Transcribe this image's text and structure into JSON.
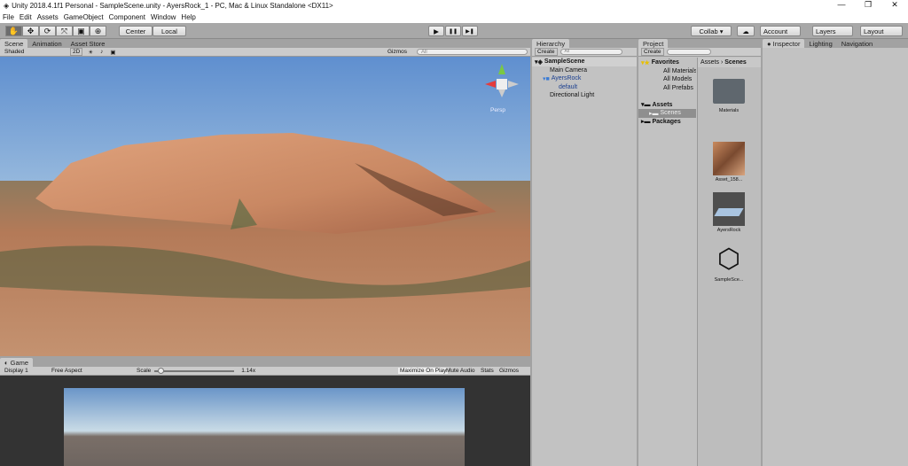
{
  "window": {
    "title": "Unity 2018.4.1f1 Personal - SampleScene.unity - AyersRock_1 - PC, Mac & Linux Standalone <DX11>",
    "controls": [
      "—",
      "❐",
      "✕"
    ]
  },
  "menu": [
    "File",
    "Edit",
    "Assets",
    "GameObject",
    "Component",
    "Window",
    "Help"
  ],
  "toolbar": {
    "tools": [
      "✋",
      "✥",
      "⟳",
      "⤧",
      "▣",
      "⊕"
    ],
    "pivot": "Center",
    "space": "Local",
    "play": "▶",
    "pause": "❚❚",
    "step": "▶❚",
    "collab": "Collab ▾",
    "cloud": "☁",
    "account": "Account",
    "layers": "Layers",
    "layout": "Layout"
  },
  "scene": {
    "tabs": [
      "Scene",
      "Animation",
      "Asset Store"
    ],
    "shading": "Shaded",
    "mode2d": "2D",
    "gizmos": "Gizmos",
    "search_placeholder": "All",
    "view_label": "Persp"
  },
  "game": {
    "tab": "Game",
    "display": "Display 1",
    "aspect": "Free Aspect",
    "scale_label": "Scale",
    "scale_value": "1.14x",
    "scale_fraction": 0.05,
    "maximize": "Maximize On Play",
    "mute": "Mute Audio",
    "stats": "Stats",
    "gizmos": "Gizmos"
  },
  "hierarchy": {
    "tab": "Hierarchy",
    "create": "Create",
    "search_placeholder": "All",
    "items": [
      {
        "label": "SampleScene",
        "level": 0
      },
      {
        "label": "Main Camera",
        "level": 1
      },
      {
        "label": "AyersRock",
        "level": 1
      },
      {
        "label": "default",
        "level": 2
      },
      {
        "label": "Directional Light",
        "level": 1
      }
    ]
  },
  "project": {
    "tab": "Project",
    "create": "Create",
    "favorites": "Favorites",
    "fav_items": [
      "All Materials",
      "All Models",
      "All Prefabs"
    ],
    "assets": "Assets",
    "scenes": "Scenes",
    "packages": "Packages",
    "breadcrumb": [
      "Assets",
      "Scenes"
    ],
    "files": [
      "Materials",
      "Asset_158...",
      "AyersRock",
      "SampleSce..."
    ]
  },
  "inspector": {
    "tabs": [
      "Inspector",
      "Lighting",
      "Navigation"
    ]
  }
}
